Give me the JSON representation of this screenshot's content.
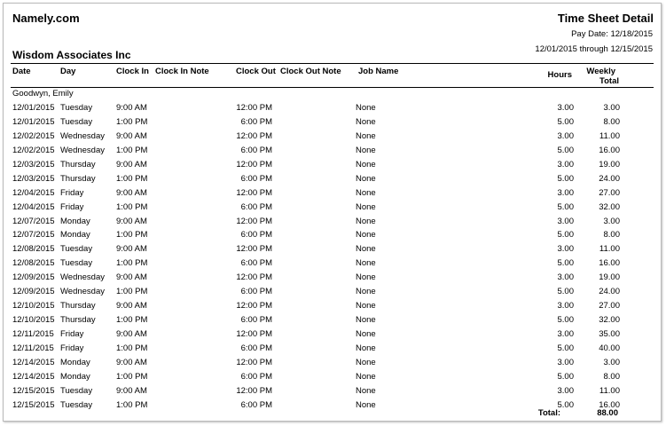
{
  "header": {
    "company": "Namely.com",
    "report_title": "Time Sheet Detail",
    "pay_date": "Pay Date:  12/18/2015",
    "period": "12/01/2015  through  12/15/2015",
    "organization": "Wisdom Associates Inc"
  },
  "columns": {
    "date": "Date",
    "day": "Day",
    "clock_in": "Clock In",
    "clock_in_note": "Clock In Note",
    "clock_out": "Clock Out",
    "clock_out_note": "Clock Out Note",
    "job_name": "Job Name",
    "hours": "Hours",
    "weekly_total_line1": "Weekly",
    "weekly_total_line2": "Total"
  },
  "employee": "Goodwyn, Emily",
  "rows": [
    {
      "date": "12/01/2015",
      "day": "Tuesday",
      "clock_in": "9:00 AM",
      "clock_out": "12:00 PM",
      "job": "None",
      "hours": "3.00",
      "weekly": "3.00"
    },
    {
      "date": "12/01/2015",
      "day": "Tuesday",
      "clock_in": "1:00 PM",
      "clock_out": "6:00 PM",
      "job": "None",
      "hours": "5.00",
      "weekly": "8.00"
    },
    {
      "date": "12/02/2015",
      "day": "Wednesday",
      "clock_in": "9:00 AM",
      "clock_out": "12:00 PM",
      "job": "None",
      "hours": "3.00",
      "weekly": "11.00"
    },
    {
      "date": "12/02/2015",
      "day": "Wednesday",
      "clock_in": "1:00 PM",
      "clock_out": "6:00 PM",
      "job": "None",
      "hours": "5.00",
      "weekly": "16.00"
    },
    {
      "date": "12/03/2015",
      "day": "Thursday",
      "clock_in": "9:00 AM",
      "clock_out": "12:00 PM",
      "job": "None",
      "hours": "3.00",
      "weekly": "19.00"
    },
    {
      "date": "12/03/2015",
      "day": "Thursday",
      "clock_in": "1:00 PM",
      "clock_out": "6:00 PM",
      "job": "None",
      "hours": "5.00",
      "weekly": "24.00"
    },
    {
      "date": "12/04/2015",
      "day": "Friday",
      "clock_in": "9:00 AM",
      "clock_out": "12:00 PM",
      "job": "None",
      "hours": "3.00",
      "weekly": "27.00"
    },
    {
      "date": "12/04/2015",
      "day": "Friday",
      "clock_in": "1:00 PM",
      "clock_out": "6:00 PM",
      "job": "None",
      "hours": "5.00",
      "weekly": "32.00"
    },
    {
      "date": "12/07/2015",
      "day": "Monday",
      "clock_in": "9:00 AM",
      "clock_out": "12:00 PM",
      "job": "None",
      "hours": "3.00",
      "weekly": "3.00"
    },
    {
      "date": "12/07/2015",
      "day": "Monday",
      "clock_in": "1:00 PM",
      "clock_out": "6:00 PM",
      "job": "None",
      "hours": "5.00",
      "weekly": "8.00"
    },
    {
      "date": "12/08/2015",
      "day": "Tuesday",
      "clock_in": "9:00 AM",
      "clock_out": "12:00 PM",
      "job": "None",
      "hours": "3.00",
      "weekly": "11.00"
    },
    {
      "date": "12/08/2015",
      "day": "Tuesday",
      "clock_in": "1:00 PM",
      "clock_out": "6:00 PM",
      "job": "None",
      "hours": "5.00",
      "weekly": "16.00"
    },
    {
      "date": "12/09/2015",
      "day": "Wednesday",
      "clock_in": "9:00 AM",
      "clock_out": "12:00 PM",
      "job": "None",
      "hours": "3.00",
      "weekly": "19.00"
    },
    {
      "date": "12/09/2015",
      "day": "Wednesday",
      "clock_in": "1:00 PM",
      "clock_out": "6:00 PM",
      "job": "None",
      "hours": "5.00",
      "weekly": "24.00"
    },
    {
      "date": "12/10/2015",
      "day": "Thursday",
      "clock_in": "9:00 AM",
      "clock_out": "12:00 PM",
      "job": "None",
      "hours": "3.00",
      "weekly": "27.00"
    },
    {
      "date": "12/10/2015",
      "day": "Thursday",
      "clock_in": "1:00 PM",
      "clock_out": "6:00 PM",
      "job": "None",
      "hours": "5.00",
      "weekly": "32.00"
    },
    {
      "date": "12/11/2015",
      "day": "Friday",
      "clock_in": "9:00 AM",
      "clock_out": "12:00 PM",
      "job": "None",
      "hours": "3.00",
      "weekly": "35.00"
    },
    {
      "date": "12/11/2015",
      "day": "Friday",
      "clock_in": "1:00 PM",
      "clock_out": "6:00 PM",
      "job": "None",
      "hours": "5.00",
      "weekly": "40.00"
    },
    {
      "date": "12/14/2015",
      "day": "Monday",
      "clock_in": "9:00 AM",
      "clock_out": "12:00 PM",
      "job": "None",
      "hours": "3.00",
      "weekly": "3.00"
    },
    {
      "date": "12/14/2015",
      "day": "Monday",
      "clock_in": "1:00 PM",
      "clock_out": "6:00 PM",
      "job": "None",
      "hours": "5.00",
      "weekly": "8.00"
    },
    {
      "date": "12/15/2015",
      "day": "Tuesday",
      "clock_in": "9:00 AM",
      "clock_out": "12:00 PM",
      "job": "None",
      "hours": "3.00",
      "weekly": "11.00"
    },
    {
      "date": "12/15/2015",
      "day": "Tuesday",
      "clock_in": "1:00 PM",
      "clock_out": "6:00 PM",
      "job": "None",
      "hours": "5.00",
      "weekly": "16.00"
    }
  ],
  "footer": {
    "total_label": "Total:",
    "total_value": "88.00"
  }
}
